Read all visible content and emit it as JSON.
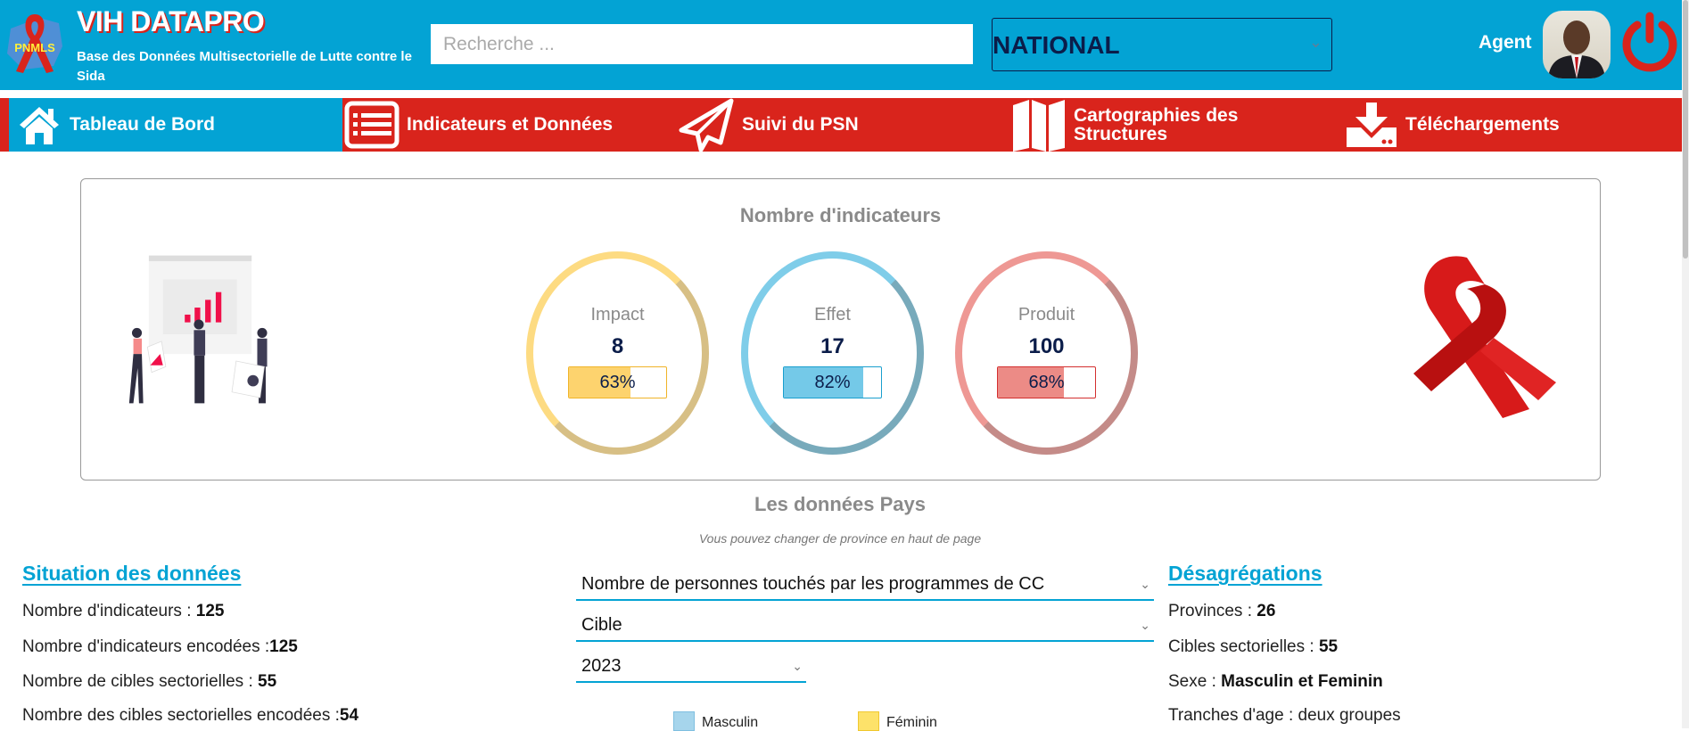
{
  "header": {
    "logo_text": "PNMLS",
    "title": "VIH DATAPRO",
    "subtitle": "Base des Données Multisectorielle de Lutte contre le Sida",
    "search_placeholder": "Recherche ...",
    "region": "NATIONAL",
    "user_label": "Agent"
  },
  "nav": [
    {
      "label": "Tableau de Bord",
      "icon": "home-icon"
    },
    {
      "label": "Indicateurs et Données",
      "icon": "list-icon"
    },
    {
      "label": "Suivi du PSN",
      "icon": "paper-plane-icon"
    },
    {
      "label": "Cartographies des Structures",
      "icon": "map-icon"
    },
    {
      "label": "Téléchargements",
      "icon": "download-icon"
    }
  ],
  "indicators": {
    "title": "Nombre d'indicateurs",
    "items": [
      {
        "label": "Impact",
        "count": "8",
        "percent": "63%",
        "percent_value": 63,
        "color": "#fdd36e",
        "border": "#f0b429"
      },
      {
        "label": "Effet",
        "count": "17",
        "percent": "82%",
        "percent_value": 82,
        "color": "#74c9e8",
        "border": "#1a9fce"
      },
      {
        "label": "Produit",
        "count": "100",
        "percent": "68%",
        "percent_value": 68,
        "color": "#ec8b86",
        "border": "#d32f2f"
      }
    ]
  },
  "country": {
    "title": "Les données Pays",
    "subtitle": "Vous pouvez changer de province en haut de page"
  },
  "situation": {
    "title": "Situation des données",
    "lines": [
      {
        "label": "Nombre d'indicateurs : ",
        "value": "125"
      },
      {
        "label": "Nombre d'indicateurs encodées :",
        "value": "125"
      },
      {
        "label": "Nombre de cibles sectorielles : ",
        "value": "55"
      },
      {
        "label": "Nombre des cibles sectorielles encodées :",
        "value": "54"
      }
    ]
  },
  "filters": {
    "indicator": "Nombre de personnes touchés par les programmes de CC",
    "type": "Cible",
    "year": "2023"
  },
  "legend": [
    {
      "label": "Masculin",
      "color": "#a6d5ec"
    },
    {
      "label": "Féminin",
      "color": "#fde26a"
    }
  ],
  "disaggregations": {
    "title": "Désagrégations",
    "lines": [
      {
        "label": "Provinces : ",
        "value": "26"
      },
      {
        "label": "Cibles sectorielles : ",
        "value": "55"
      },
      {
        "label": "Sexe : ",
        "value": "Masculin et Feminin"
      },
      {
        "label": "Tranches d'age : deux groupes",
        "value": ""
      }
    ]
  },
  "colors": {
    "header": "#03a3d4",
    "nav": "#d9241c",
    "navy": "#0b1d4a"
  }
}
